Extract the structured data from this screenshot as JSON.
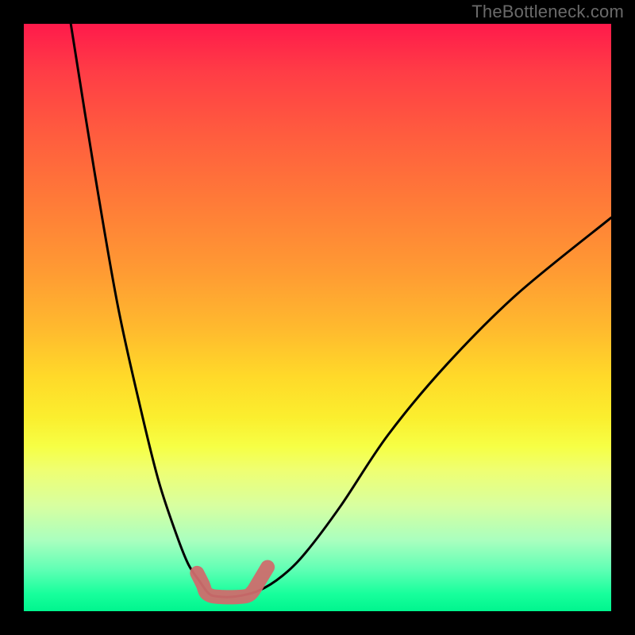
{
  "watermark": "TheBottleneck.com",
  "chart_data": {
    "type": "line",
    "title": "",
    "xlabel": "",
    "ylabel": "",
    "xlim": [
      0,
      100
    ],
    "ylim": [
      0,
      100
    ],
    "grid": false,
    "series": [
      {
        "name": "black-curve",
        "color": "#000000",
        "x": [
          8,
          12,
          16,
          20,
          23,
          26,
          28,
          30,
          31.5,
          33,
          36,
          40,
          44,
          48,
          54,
          62,
          72,
          84,
          100
        ],
        "values": [
          100,
          75,
          52,
          34,
          22,
          13,
          8,
          5,
          3,
          2.5,
          2.5,
          3.5,
          6,
          10,
          18,
          30,
          42,
          54,
          67
        ]
      },
      {
        "name": "marker-band",
        "color": "#cf6d6d",
        "x": [
          29.5,
          30.5,
          31,
          32,
          34,
          36,
          38,
          39,
          40,
          41.5
        ],
        "values": [
          6.5,
          4.5,
          3.2,
          2.6,
          2.4,
          2.4,
          2.6,
          3.4,
          5.0,
          7.5
        ]
      }
    ]
  }
}
